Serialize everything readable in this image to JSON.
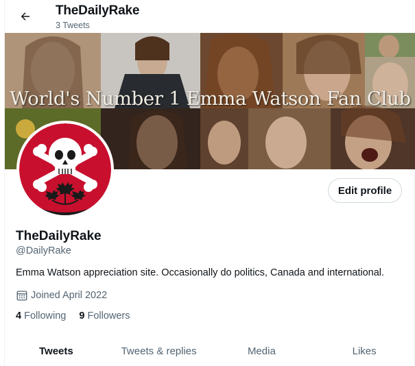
{
  "header": {
    "title": "TheDailyRake",
    "tweet_count": "3 Tweets"
  },
  "banner": {
    "text": "World's Number 1 Emma Watson Fan Club"
  },
  "profile": {
    "edit_label": "Edit profile",
    "name": "TheDailyRake",
    "handle": "@DailyRake",
    "bio": "Emma Watson appreciation site. Occasionally do politics, Canada and international.",
    "joined": "Joined April 2022",
    "following_count": "4",
    "following_label": "Following",
    "followers_count": "9",
    "followers_label": "Followers"
  },
  "tabs": [
    {
      "label": "Tweets"
    },
    {
      "label": "Tweets & replies"
    },
    {
      "label": "Media"
    },
    {
      "label": "Likes"
    }
  ],
  "colors": {
    "avatar_red": "#c8102e",
    "text_primary": "#0f1419",
    "text_secondary": "#536471"
  },
  "icons": {
    "back": "back-arrow-icon",
    "calendar": "calendar-icon"
  }
}
